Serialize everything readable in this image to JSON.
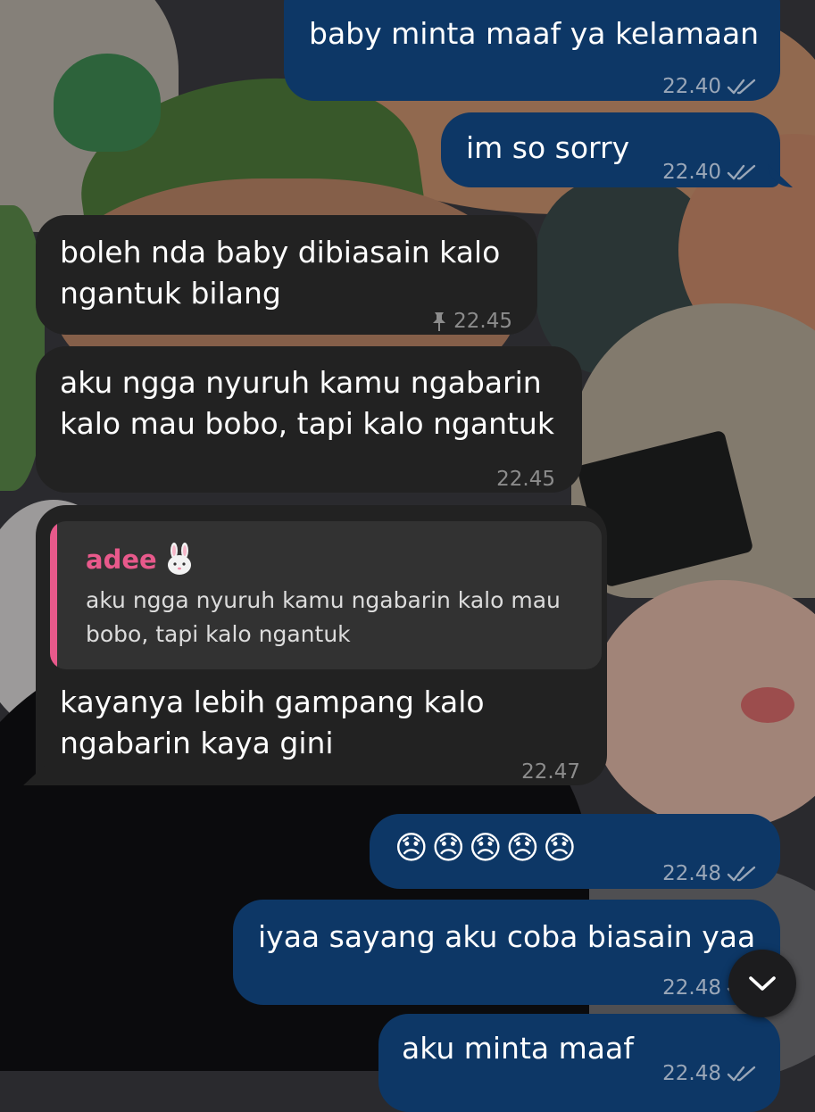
{
  "messages": [
    {
      "dir": "out",
      "text": "baby minta maaf ya kelamaan",
      "time": "22.40",
      "status": "read"
    },
    {
      "dir": "out",
      "text": "im so sorry",
      "time": "22.40",
      "status": "read"
    },
    {
      "dir": "in",
      "text": "boleh nda baby dibiasain kalo\nngantuk bilang",
      "time": "22.45",
      "pinned": true
    },
    {
      "dir": "in",
      "text": "aku ngga nyuruh kamu ngabarin\nkalo mau bobo, tapi kalo ngantuk",
      "time": "22.45"
    },
    {
      "dir": "in",
      "reply": {
        "name": "adee",
        "text": "aku ngga nyuruh kamu ngabarin kalo mau\nbobo, tapi kalo ngantuk"
      },
      "text": "kayanya lebih gampang kalo\nngabarin kaya gini",
      "time": "22.47"
    },
    {
      "dir": "out",
      "text": "😞😞😞😞😞",
      "time": "22.48",
      "status": "read"
    },
    {
      "dir": "out",
      "text": "iyaa sayang aku coba biasain yaa",
      "time": "22.48",
      "status": "read"
    },
    {
      "dir": "out",
      "text": "aku minta maaf",
      "time": "22.48",
      "status": "read"
    }
  ],
  "icons": {
    "pin": "pin-icon",
    "read": "double-check-icon",
    "scroll": "chevron-down-icon",
    "emoji": "rabbit-face"
  },
  "colors": {
    "outgoing_bubble": "#0d3766",
    "incoming_bubble": "#222222",
    "reply_accent": "#e8598b"
  }
}
